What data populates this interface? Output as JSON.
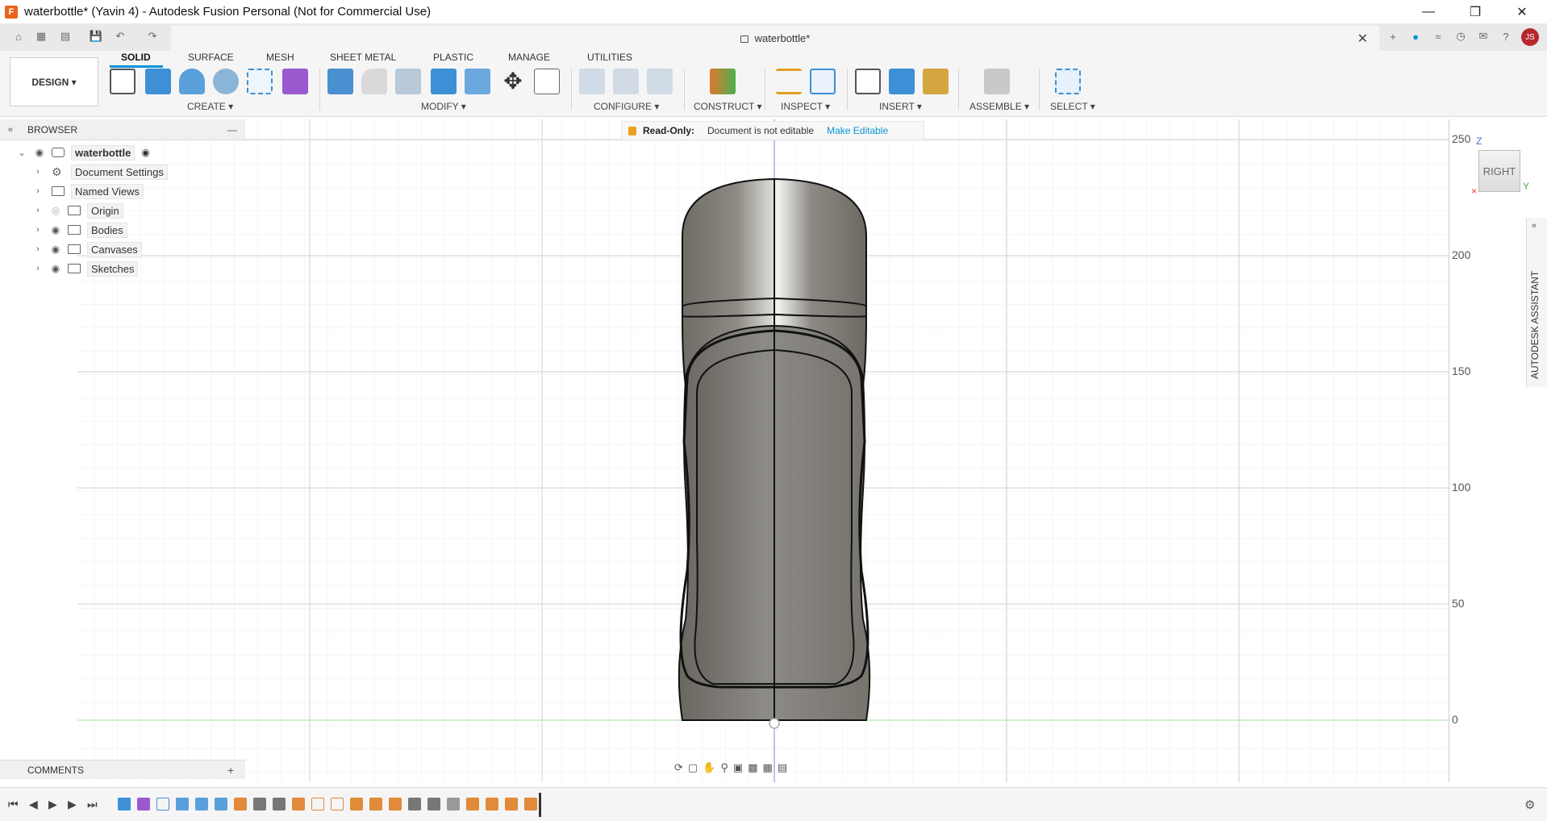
{
  "window": {
    "title": "waterbottle* (Yavin 4) - Autodesk Fusion Personal (Not for Commercial Use)",
    "app_logo": "F"
  },
  "doc_tab": {
    "title": "waterbottle*"
  },
  "workspace": {
    "label": "DESIGN ▾"
  },
  "ribbon": {
    "tabs": [
      "SOLID",
      "SURFACE",
      "MESH",
      "SHEET METAL",
      "PLASTIC",
      "MANAGE",
      "UTILITIES"
    ],
    "groups": [
      "CREATE ▾",
      "MODIFY ▾",
      "CONFIGURE ▾",
      "CONSTRUCT ▾",
      "INSPECT ▾",
      "INSERT ▾",
      "ASSEMBLE ▾",
      "SELECT ▾"
    ]
  },
  "browser": {
    "title": "BROWSER",
    "root": "waterbottle",
    "items": [
      "Document Settings",
      "Named Views",
      "Origin",
      "Bodies",
      "Canvases",
      "Sketches"
    ]
  },
  "readonly": {
    "label": "Read-Only:",
    "message": "Document is not editable",
    "action": "Make Editable"
  },
  "ruler": {
    "ticks": [
      "250",
      "200",
      "150",
      "100",
      "50",
      "0"
    ]
  },
  "viewcube": {
    "face": "RIGHT",
    "z": "Z",
    "y": "Y"
  },
  "assistant": {
    "label": "AUTODESK ASSISTANT"
  },
  "comments": {
    "label": "COMMENTS",
    "add": "+"
  }
}
